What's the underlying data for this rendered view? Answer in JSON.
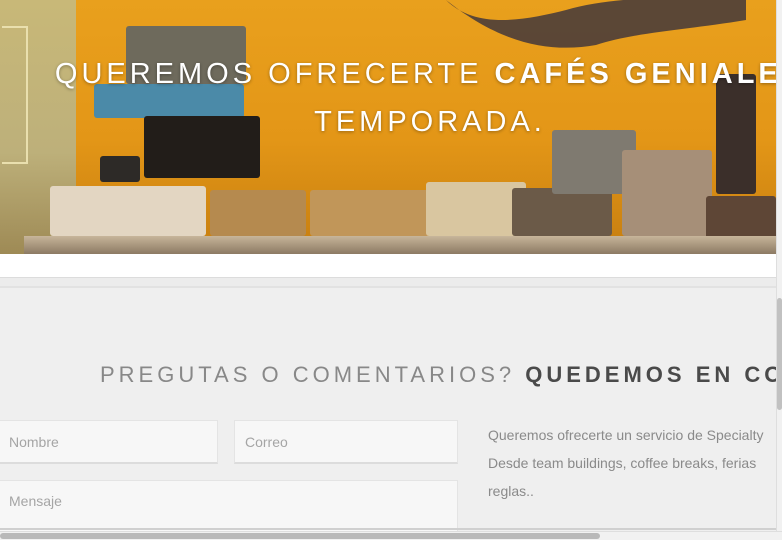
{
  "hero": {
    "title_light": "QUEREMOS OFRECERTE ",
    "title_bold": "CAFÉS GENIALES",
    "title_line2": "TEMPORADA."
  },
  "contact": {
    "heading_light": "PREGUTAS O COMENTARIOS? ",
    "heading_bold": "QUEDEMOS EN CONTACTO",
    "nombre_placeholder": "Nombre",
    "correo_placeholder": "Correo",
    "mensaje_placeholder": "Mensaje",
    "description": "Queremos ofrecerte un servicio de Specialty\nDesde team buildings, coffee breaks, ferias\nreglas.."
  },
  "colors": {
    "hero_wall": "#e39617",
    "heading_light": "#888888",
    "heading_bold": "#4a4a4a",
    "body_text": "#8a8a8a"
  }
}
